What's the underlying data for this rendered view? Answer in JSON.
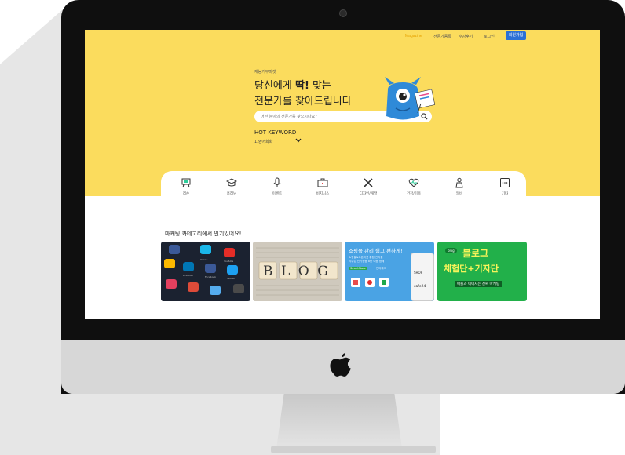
{
  "nav": {
    "magazine": "Magazine",
    "expert_register": "전문가등록",
    "review": "수강후기",
    "login": "로그인",
    "signup": "회원가입"
  },
  "hero": {
    "tagline": "재능기부마켓",
    "headline_part1": "당신에게 ",
    "headline_bold": "딱!",
    "headline_part2": " 맞는",
    "headline_line2": "전문가를 찾아드립니다",
    "search_placeholder": "어떤 분야의 전문가를 찾으시나요?"
  },
  "hot_keyword": {
    "label": "HOT KEYWORD",
    "value": "1.영어회화"
  },
  "categories": [
    {
      "label": "레슨",
      "icon": "easel-icon"
    },
    {
      "label": "홈러닝",
      "icon": "graduation-cap-icon"
    },
    {
      "label": "이벤트",
      "icon": "microphone-icon"
    },
    {
      "label": "비지니스",
      "icon": "briefcase-icon"
    },
    {
      "label": "디자인/개발",
      "icon": "pencil-ruler-icon"
    },
    {
      "label": "건강/미용",
      "icon": "heart-pulse-icon"
    },
    {
      "label": "알바",
      "icon": "worker-icon"
    },
    {
      "label": "기타",
      "icon": "more-icon"
    }
  ],
  "section": {
    "title": "마케팅 카테고리에서 인기있어요!"
  },
  "cards": {
    "card2_text": "BLOG",
    "card3_title": "쇼핑몰 관리 쉽고 편하게!",
    "card3_sub1": "쇼핑몰&오픈마켓 통합 관리를",
    "card3_sub2": "직수입 인기상품 8만 여종 함께",
    "card3_smartstore": "SmartStore",
    "card3_brand2": "인터파크",
    "card3_shop": "SHOP",
    "card3_cafe": "cafe24",
    "card4_badge": "blog",
    "card4_line1": "블로그",
    "card4_line2": "체험단+기자단",
    "card4_sub": "매출과 이어지는 진짜 마케팅",
    "card1_labels": [
      "Vimeo",
      "YouTube",
      "LinkedIn",
      "Facebook",
      "Twitter"
    ]
  },
  "colors": {
    "hero_bg": "#fbdc5d",
    "signup_btn": "#2b70d6",
    "magazine_link": "#e6a200",
    "mascot": "#2f8ad8"
  }
}
